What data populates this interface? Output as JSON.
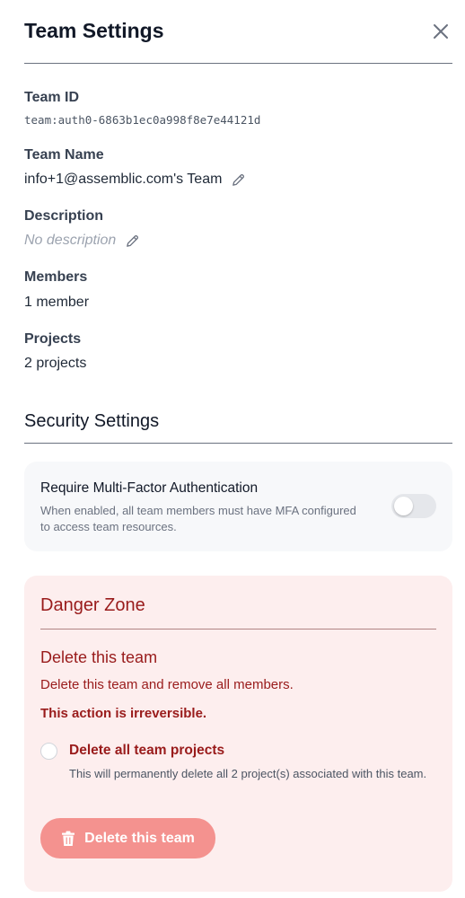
{
  "header": {
    "title": "Team Settings"
  },
  "details": {
    "team_id": {
      "label": "Team ID",
      "value": "team:auth0-6863b1ec0a998f8e7e44121d"
    },
    "team_name": {
      "label": "Team Name",
      "value": "info+1@assemblic.com's Team"
    },
    "description": {
      "label": "Description",
      "value": "No description"
    },
    "members": {
      "label": "Members",
      "value": "1 member"
    },
    "projects": {
      "label": "Projects",
      "value": "2 projects"
    }
  },
  "security": {
    "title": "Security Settings",
    "mfa": {
      "title": "Require Multi-Factor Authentication",
      "description": "When enabled, all team members must have MFA configured to access team resources.",
      "enabled": false
    }
  },
  "danger_zone": {
    "title": "Danger Zone",
    "subtitle": "Delete this team",
    "description": "Delete this team and remove all members.",
    "warning": "This action is irreversible.",
    "delete_projects": {
      "label": "Delete all team projects",
      "description": "This will permanently delete all 2 project(s) associated with this team.",
      "checked": false
    },
    "delete_button": "Delete this team"
  },
  "colors": {
    "danger_text": "#991b1b",
    "danger_bg": "#fdeeee",
    "danger_button": "#f4928f"
  },
  "icons": [
    "close-icon",
    "pencil-icon",
    "trash-icon"
  ]
}
